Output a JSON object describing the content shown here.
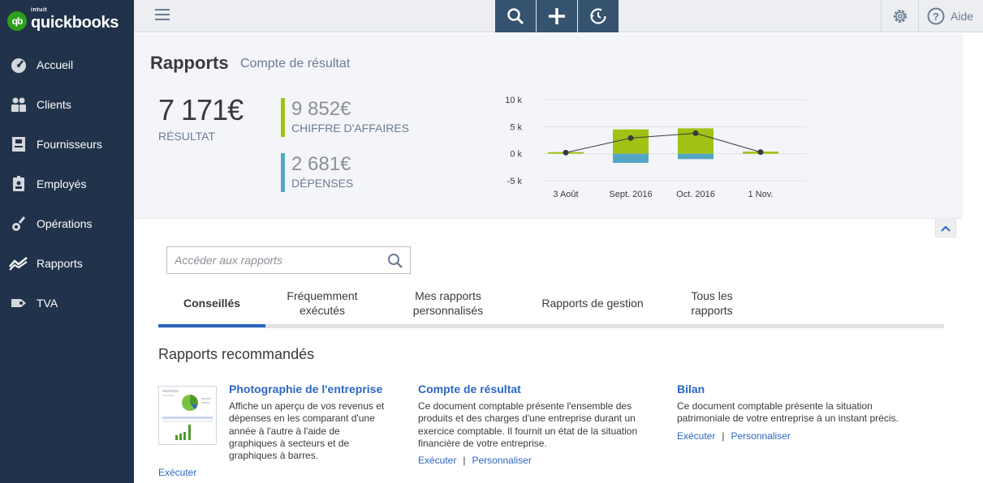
{
  "app": {
    "logo_brand": "intuit",
    "logo_name": "quickbooks",
    "logo_badge": "qb"
  },
  "sidebar": {
    "items": [
      {
        "label": "Accueil",
        "icon": "dashboard-icon"
      },
      {
        "label": "Clients",
        "icon": "clients-icon"
      },
      {
        "label": "Fournisseurs",
        "icon": "suppliers-icon"
      },
      {
        "label": "Employés",
        "icon": "employees-icon"
      },
      {
        "label": "Opérations",
        "icon": "operations-icon"
      },
      {
        "label": "Rapports",
        "icon": "reports-icon",
        "active": true
      },
      {
        "label": "TVA",
        "icon": "vat-icon"
      }
    ]
  },
  "topbar": {
    "help_label": "Aide"
  },
  "header": {
    "title": "Rapports",
    "subtitle": "Compte de résultat",
    "net_amount": "7 171€",
    "net_label": "RÉSULTAT",
    "income_value": "9 852€",
    "income_label": "CHIFFRE D'AFFAIRES",
    "expense_value": "2 681€",
    "expense_label": "DÉPENSES"
  },
  "chart_data": {
    "type": "bar",
    "categories": [
      "3 Août",
      "Sept. 2016",
      "Oct. 2016",
      "1 Nov."
    ],
    "series": [
      {
        "values": [
          300,
          4500,
          4700,
          400
        ],
        "color": "#a0c214"
      },
      {
        "values": [
          0,
          -1700,
          -1000,
          0
        ],
        "color": "#54a6c4"
      },
      {
        "values": [
          200,
          2900,
          3800,
          300
        ],
        "color": "#393a3d",
        "kind": "line"
      }
    ],
    "ylim": [
      -5000,
      10000
    ],
    "yticks": [
      "10 k",
      "5 k",
      "0 k",
      "-5 k"
    ],
    "ytick_values": [
      10000,
      5000,
      0,
      -5000
    ],
    "grid": true
  },
  "search": {
    "placeholder": "Accéder aux rapports"
  },
  "tabs": [
    {
      "line1": "Conseillés",
      "line2": ""
    },
    {
      "line1": "Fréquemment",
      "line2": "exécutés"
    },
    {
      "line1": "Mes rapports",
      "line2": "personnalisés"
    },
    {
      "line1": "Rapports de gestion",
      "line2": ""
    },
    {
      "line1": "Tous les",
      "line2": "rapports"
    }
  ],
  "recommended": {
    "title": "Rapports recommandés",
    "cards": [
      {
        "title": "Photographie de l'entreprise",
        "desc": [
          "Affiche un aperçu de vos revenus et",
          "dépenses en les comparant d'une",
          "année à l'autre à l'aide de",
          "graphiques à secteurs et de",
          "graphiques à barres."
        ],
        "run": "Exécuter"
      },
      {
        "title": "Compte de résultat",
        "desc": [
          "Ce document comptable présente l'ensemble des",
          "produits et des charges d'une entreprise durant un",
          "exercice comptable. Il fournit un état de la situation",
          "financière de votre entreprise."
        ],
        "run": "Exécuter",
        "customize": "Personnaliser"
      },
      {
        "title": "Bilan",
        "desc": [
          "Ce document comptable présente la situation",
          "patrimoniale de votre entreprise à un instant précis."
        ],
        "run": "Exécuter",
        "customize": "Personnaliser"
      }
    ]
  }
}
